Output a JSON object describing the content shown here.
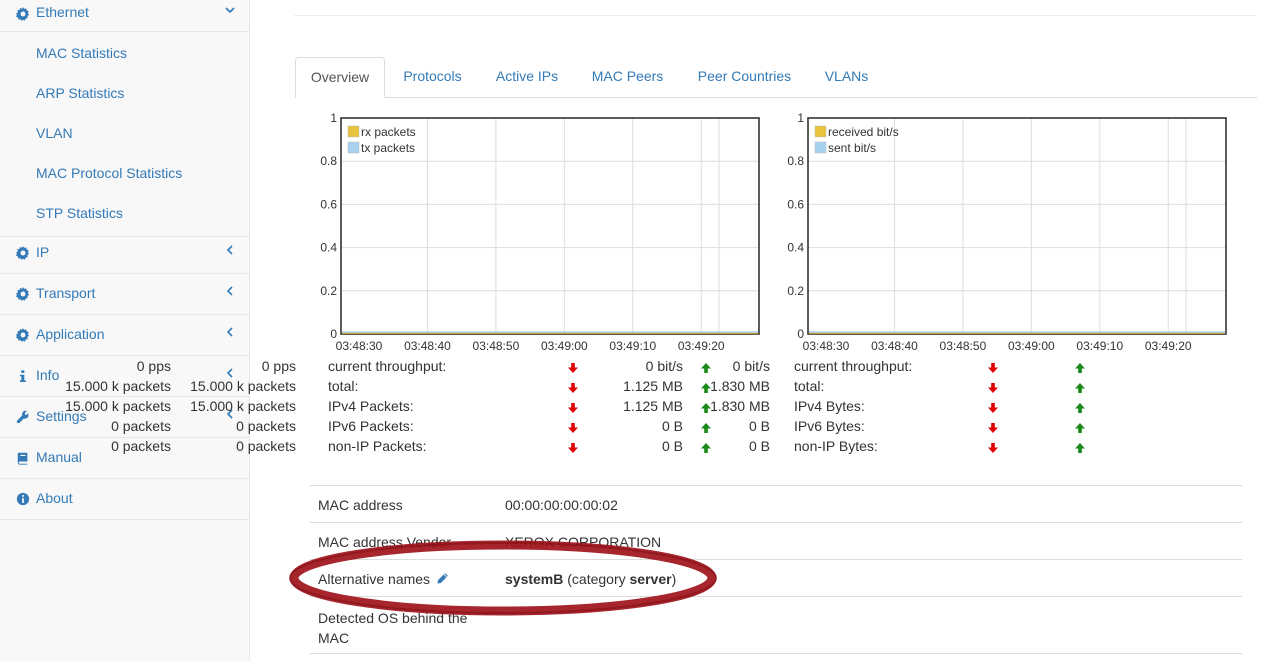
{
  "sidebar": {
    "ethernet": {
      "label": "Ethernet",
      "icon": "gear-icon"
    },
    "ethernet_items": [
      "MAC Statistics",
      "ARP Statistics",
      "VLAN",
      "MAC Protocol Statistics",
      "STP Statistics"
    ],
    "groups": [
      {
        "label": "IP",
        "icon": "gear-icon",
        "expandable": true
      },
      {
        "label": "Transport",
        "icon": "gear-icon",
        "expandable": true
      },
      {
        "label": "Application",
        "icon": "gear-icon",
        "expandable": true
      },
      {
        "label": "Info",
        "icon": "info-icon",
        "expandable": true
      },
      {
        "label": "Settings",
        "icon": "wrench-icon",
        "expandable": true
      },
      {
        "label": "Manual",
        "icon": "book-icon",
        "expandable": false
      },
      {
        "label": "About",
        "icon": "info-circle-icon",
        "expandable": false
      }
    ]
  },
  "tabs": [
    "Overview",
    "Protocols",
    "Active IPs",
    "MAC Peers",
    "Peer Countries",
    "VLANs"
  ],
  "active_tab": "Overview",
  "chart_data": [
    {
      "type": "line",
      "x": [
        "03:48:30",
        "03:48:40",
        "03:48:50",
        "03:49:00",
        "03:49:10",
        "03:49:20"
      ],
      "series": [
        {
          "name": "rx packets",
          "values": [
            0,
            0,
            0,
            0,
            0,
            0
          ],
          "color": "#e8c43c"
        },
        {
          "name": "tx packets",
          "values": [
            0,
            0,
            0,
            0,
            0,
            0
          ],
          "color": "#a8d0ef"
        }
      ],
      "ylim": [
        0,
        1
      ],
      "yticks": [
        "0",
        "0.2",
        "0.4",
        "0.6",
        "0.8",
        "1"
      ],
      "grid": true,
      "legend": "top-left"
    },
    {
      "type": "line",
      "x": [
        "03:48:30",
        "03:48:40",
        "03:48:50",
        "03:49:00",
        "03:49:10",
        "03:49:20"
      ],
      "series": [
        {
          "name": "received bit/s",
          "values": [
            0,
            0,
            0,
            0,
            0,
            0
          ],
          "color": "#e8c43c"
        },
        {
          "name": "sent bit/s",
          "values": [
            0,
            0,
            0,
            0,
            0,
            0
          ],
          "color": "#a8d0ef"
        }
      ],
      "ylim": [
        0,
        1
      ],
      "yticks": [
        "0",
        "0.2",
        "0.4",
        "0.6",
        "0.8",
        "1"
      ],
      "grid": true,
      "legend": "top-left"
    }
  ],
  "packet_stats": [
    {
      "label": "current throughput:",
      "rx": "0 pps",
      "tx": "0 pps"
    },
    {
      "label": "total:",
      "rx": "15.000 k packets",
      "tx": "15.000 k packets"
    },
    {
      "label": "IPv4 Packets:",
      "rx": "15.000 k packets",
      "tx": "15.000 k packets"
    },
    {
      "label": "IPv6 Packets:",
      "rx": "0 packets",
      "tx": "0 packets"
    },
    {
      "label": "non-IP Packets:",
      "rx": "0 packets",
      "tx": "0 packets"
    }
  ],
  "byte_stats": [
    {
      "label": "current throughput:",
      "rx": "0 bit/s",
      "tx": "0 bit/s"
    },
    {
      "label": "total:",
      "rx": "1.125 MB",
      "tx": "1.830 MB"
    },
    {
      "label": "IPv4 Bytes:",
      "rx": "1.125 MB",
      "tx": "1.830 MB"
    },
    {
      "label": "IPv6 Bytes:",
      "rx": "0 B",
      "tx": "0 B"
    },
    {
      "label": "non-IP Bytes:",
      "rx": "0 B",
      "tx": "0 B"
    }
  ],
  "colors": {
    "down_arrow": "#e00000",
    "up_arrow": "#1a8a1a",
    "link": "#337ab7",
    "annotation": "#a0121a"
  },
  "info": {
    "mac_address": {
      "label": "MAC address",
      "value": "00:00:00:00:00:02"
    },
    "vendor": {
      "label": "MAC address Vendor",
      "value": "XEROX CORPORATION"
    },
    "alt_names": {
      "label": "Alternative names",
      "name": "systemB",
      "pre": "(category ",
      "category": "server",
      "post": ")"
    },
    "os": {
      "label_line1": "Detected OS behind the",
      "label_line2": "MAC"
    }
  }
}
